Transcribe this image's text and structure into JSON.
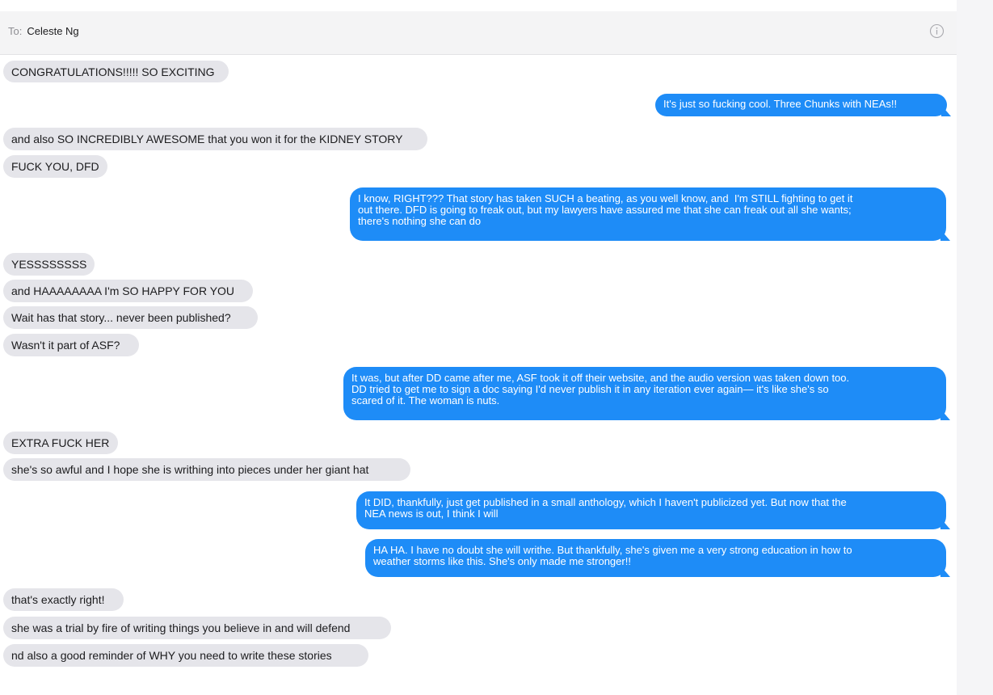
{
  "header": {
    "to_label": "To:",
    "recipient": "Celeste Ng",
    "info_icon": "info-icon"
  },
  "messages": [
    {
      "dir": "recv",
      "text": "CONGRATULATIONS!!!!! SO EXCITING"
    },
    {
      "dir": "sent",
      "text": "It's just so fucking cool. Three Chunks with NEAs!!"
    },
    {
      "dir": "recv",
      "text": "and also SO INCREDIBLY AWESOME that you won it for the KIDNEY STORY"
    },
    {
      "dir": "recv",
      "text": "FUCK YOU, DFD"
    },
    {
      "dir": "sent",
      "text": "I know, RIGHT??? That story has taken SUCH a beating, as you well know, and  I'm STILL fighting to get it\nout there. DFD is going to freak out, but my lawyers have assured me that she can freak out all she wants;\nthere's nothing she can do"
    },
    {
      "dir": "recv",
      "text": "YESSSSSSSS"
    },
    {
      "dir": "recv",
      "text": "and HAAAAAAAA I'm SO HAPPY FOR YOU"
    },
    {
      "dir": "recv",
      "text": "Wait has that story... never been published?"
    },
    {
      "dir": "recv",
      "text": "Wasn't it part of ASF?"
    },
    {
      "dir": "sent",
      "text": "It was, but after DD came after me, ASF took it off their website, and the audio version was taken down too.\nDD tried to get me to sign a doc saying I'd never publish it in any iteration ever again— it's like she's so\nscared of it. The woman is nuts."
    },
    {
      "dir": "recv",
      "text": "EXTRA FUCK HER"
    },
    {
      "dir": "recv",
      "text": "she's so awful and I hope she is writhing into pieces under her giant hat"
    },
    {
      "dir": "sent",
      "text": "It DID, thankfully, just get published in a small anthology, which I haven't publicized yet. But now that the\nNEA news is out, I think I will"
    },
    {
      "dir": "sent",
      "text": "HA HA. I have no doubt she will writhe. But thankfully, she's given me a very strong education in how to\nweather storms like this. She's only made me stronger!!"
    },
    {
      "dir": "recv",
      "text": "that's exactly right!"
    },
    {
      "dir": "recv",
      "text": "she was a trial by fire of writing things you believe in and will defend"
    },
    {
      "dir": "recv",
      "text": "nd also a good reminder of WHY you need to write these stories"
    }
  ],
  "colors": {
    "sent_bubble": "#1e8cf7",
    "received_bubble": "#e5e5ea",
    "header_bg": "#f4f4f5"
  }
}
